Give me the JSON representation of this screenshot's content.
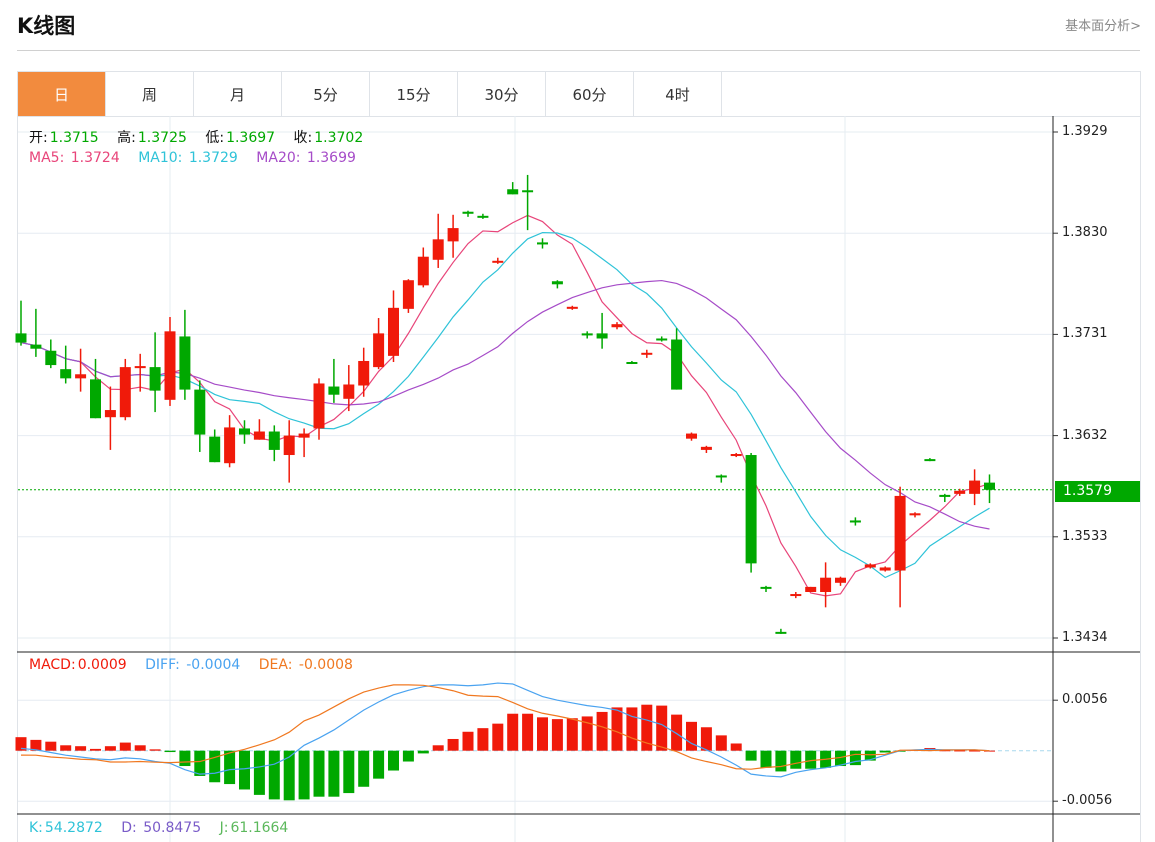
{
  "header": {
    "title": "K线图",
    "link": "基本面分析>"
  },
  "tabs": [
    {
      "label": "日",
      "active": true
    },
    {
      "label": "周"
    },
    {
      "label": "月"
    },
    {
      "label": "5分"
    },
    {
      "label": "15分"
    },
    {
      "label": "30分"
    },
    {
      "label": "60分"
    },
    {
      "label": "4时"
    }
  ],
  "ohlc": {
    "open_label": "开:",
    "open": "1.3715",
    "high_label": "高:",
    "high": "1.3725",
    "low_label": "低:",
    "low": "1.3697",
    "close_label": "收:",
    "close": "1.3702"
  },
  "ma": {
    "ma5_label": "MA5:",
    "ma5": "1.3724",
    "ma10_label": "MA10:",
    "ma10": "1.3729",
    "ma20_label": "MA20:",
    "ma20": "1.3699"
  },
  "macd_info": {
    "macd_label": "MACD:",
    "macd": "0.0009",
    "diff_label": "DIFF:",
    "diff": "-0.0004",
    "dea_label": "DEA:",
    "dea": "-0.0008"
  },
  "kdj_info": {
    "k_label": "K:",
    "k": "54.2872",
    "d_label": "D:",
    "d": "50.8475",
    "j_label": "J:",
    "j": "61.1664"
  },
  "colors": {
    "up": "#f01a0a",
    "down": "#00a800",
    "ma5": "#e8457a",
    "ma10": "#2fc3d8",
    "ma20": "#a64cc8",
    "diff": "#4aa3f0",
    "dea": "#f07820",
    "accent": "#f28b3e"
  },
  "current_price": "1.3579",
  "chart_data": {
    "type": "candlestick",
    "price_axis_ticks": [
      "1.3929",
      "1.3830",
      "1.3731",
      "1.3632",
      "1.3533",
      "1.3434"
    ],
    "price_range": [
      1.3434,
      1.3929
    ],
    "macd_axis_ticks": [
      "0.0056",
      "-0.0056"
    ],
    "macd_range": [
      -0.0056,
      0.0056
    ],
    "candles": [
      [
        1.3732,
        1.3723,
        1.3764,
        1.372
      ],
      [
        1.3721,
        1.3717,
        1.3756,
        1.3709
      ],
      [
        1.3715,
        1.3701,
        1.3726,
        1.3698
      ],
      [
        1.3697,
        1.3688,
        1.372,
        1.3683
      ],
      [
        1.3688,
        1.3692,
        1.3717,
        1.3675
      ],
      [
        1.3687,
        1.3649,
        1.3707,
        1.3649
      ],
      [
        1.365,
        1.3657,
        1.368,
        1.3618
      ],
      [
        1.365,
        1.3699,
        1.3707,
        1.3647
      ],
      [
        1.3698,
        1.37,
        1.3712,
        1.3675
      ],
      [
        1.3699,
        1.3676,
        1.3733,
        1.3655
      ],
      [
        1.3667,
        1.3734,
        1.3748,
        1.3661
      ],
      [
        1.3729,
        1.3677,
        1.3755,
        1.3667
      ],
      [
        1.3677,
        1.3633,
        1.3686,
        1.3616
      ],
      [
        1.3631,
        1.3606,
        1.3638,
        1.3606
      ],
      [
        1.3605,
        1.364,
        1.3652,
        1.3601
      ],
      [
        1.3639,
        1.3633,
        1.3647,
        1.3624
      ],
      [
        1.3628,
        1.3636,
        1.3648,
        1.3628
      ],
      [
        1.3636,
        1.3618,
        1.3642,
        1.3607
      ],
      [
        1.3613,
        1.3632,
        1.3647,
        1.3586
      ],
      [
        1.363,
        1.3634,
        1.3639,
        1.3611
      ],
      [
        1.3639,
        1.3683,
        1.3688,
        1.3628
      ],
      [
        1.368,
        1.3672,
        1.3707,
        1.3664
      ],
      [
        1.3668,
        1.3682,
        1.3701,
        1.3656
      ],
      [
        1.3681,
        1.3705,
        1.3718,
        1.367
      ],
      [
        1.3699,
        1.3732,
        1.3747,
        1.3697
      ],
      [
        1.371,
        1.3757,
        1.3774,
        1.3704
      ],
      [
        1.3756,
        1.3784,
        1.3785,
        1.3752
      ],
      [
        1.3779,
        1.3807,
        1.3816,
        1.3777
      ],
      [
        1.3804,
        1.3824,
        1.3849,
        1.3796
      ],
      [
        1.3822,
        1.3835,
        1.3848,
        1.3806
      ],
      [
        1.3851,
        1.3849,
        1.3852,
        1.3846
      ],
      [
        1.3847,
        1.3846,
        1.3849,
        1.3844
      ],
      [
        1.3802,
        1.3803,
        1.3806,
        1.38
      ],
      [
        1.3873,
        1.3868,
        1.388,
        1.3868
      ],
      [
        1.3872,
        1.3871,
        1.3887,
        1.3833
      ],
      [
        1.3821,
        1.3819,
        1.3825,
        1.3815
      ],
      [
        1.3783,
        1.378,
        1.3784,
        1.3776
      ],
      [
        1.3756,
        1.3758,
        1.3759,
        1.3755
      ],
      [
        1.3732,
        1.373,
        1.3734,
        1.3727
      ],
      [
        1.3732,
        1.3727,
        1.3752,
        1.3717
      ],
      [
        1.3738,
        1.3741,
        1.3743,
        1.3736
      ],
      [
        1.3704,
        1.3703,
        1.3705,
        1.3702
      ],
      [
        1.3712,
        1.3713,
        1.3716,
        1.3708
      ],
      [
        1.3727,
        1.3726,
        1.3729,
        1.3724
      ],
      [
        1.3726,
        1.3677,
        1.3737,
        1.3677
      ],
      [
        1.3629,
        1.3634,
        1.3635,
        1.3627
      ],
      [
        1.3618,
        1.3621,
        1.3622,
        1.3615
      ],
      [
        1.3593,
        1.3592,
        1.3594,
        1.3586
      ],
      [
        1.3612,
        1.3614,
        1.3615,
        1.3611
      ],
      [
        1.3613,
        1.3507,
        1.3615,
        1.3498
      ],
      [
        1.3484,
        1.3483,
        1.3485,
        1.3479
      ],
      [
        1.344,
        1.3439,
        1.3443,
        1.3438
      ],
      [
        1.3476,
        1.3477,
        1.3479,
        1.3473
      ],
      [
        1.3479,
        1.3484,
        1.3484,
        1.3479
      ],
      [
        1.3479,
        1.3493,
        1.3508,
        1.3464
      ],
      [
        1.3488,
        1.3493,
        1.3494,
        1.3485
      ],
      [
        1.3549,
        1.3547,
        1.3552,
        1.3544
      ],
      [
        1.3503,
        1.3506,
        1.3507,
        1.3502
      ],
      [
        1.35,
        1.3503,
        1.3504,
        1.3499
      ],
      [
        1.35,
        1.3573,
        1.3582,
        1.3464
      ],
      [
        1.3554,
        1.3556,
        1.3557,
        1.3552
      ],
      [
        1.3609,
        1.3608,
        1.361,
        1.3607
      ],
      [
        1.3574,
        1.3572,
        1.3575,
        1.3567
      ],
      [
        1.3575,
        1.3578,
        1.358,
        1.3573
      ],
      [
        1.3575,
        1.3588,
        1.3599,
        1.3564
      ],
      [
        1.3586,
        1.3579,
        1.3594,
        1.3566
      ]
    ],
    "macd": [
      0.0015,
      0.0012,
      0.001,
      0.0006,
      0.0005,
      0.0002,
      0.0005,
      0.0009,
      0.0006,
      0.00015,
      -0.00015,
      -0.0017,
      -0.0028,
      -0.0035,
      -0.0037,
      -0.0043,
      -0.0049,
      -0.0054,
      -0.0055,
      -0.0054,
      -0.0051,
      -0.0051,
      -0.0047,
      -0.004,
      -0.0031,
      -0.0022,
      -0.0012,
      -0.0003,
      0.0006,
      0.0013,
      0.0021,
      0.0025,
      0.003,
      0.0041,
      0.0041,
      0.0037,
      0.0035,
      0.0036,
      0.0038,
      0.0043,
      0.0048,
      0.0048,
      0.0051,
      0.005,
      0.004,
      0.0032,
      0.0026,
      0.0017,
      0.0008,
      -0.0011,
      -0.0019,
      -0.0023,
      -0.002,
      -0.002,
      -0.0019,
      -0.0017,
      -0.0016,
      -0.0011,
      -0.0002,
      -0.0001,
      0.0001,
      0.0003,
      5e-05,
      3e-05,
      2e-05,
      1e-05
    ],
    "diff": [
      0.00026,
      0.0001,
      -0.0002,
      -0.0005,
      -0.0007,
      -0.0009,
      -0.001,
      -0.0008,
      -0.0009,
      -0.0012,
      -0.0014,
      -0.0021,
      -0.0026,
      -0.0025,
      -0.0021,
      -0.002,
      -0.0018,
      -0.0015,
      -0.0007,
      0.0006,
      0.0014,
      0.0023,
      0.0034,
      0.0045,
      0.0054,
      0.0062,
      0.0067,
      0.0071,
      0.0073,
      0.0073,
      0.0072,
      0.0073,
      0.0075,
      0.0074,
      0.0067,
      0.006,
      0.0056,
      0.0053,
      0.005,
      0.0048,
      0.0045,
      0.0038,
      0.0034,
      0.0029,
      0.0019,
      0.0008,
      0.0001,
      -0.0007,
      -0.0016,
      -0.0026,
      -0.0028,
      -0.0029,
      -0.0024,
      -0.0021,
      -0.0019,
      -0.0016,
      -0.0012,
      -0.001,
      -0.0005,
      0.0,
      0.0001,
      0.00015,
      0.0001,
      0.0001,
      0.0001,
      0.0
    ]
  }
}
